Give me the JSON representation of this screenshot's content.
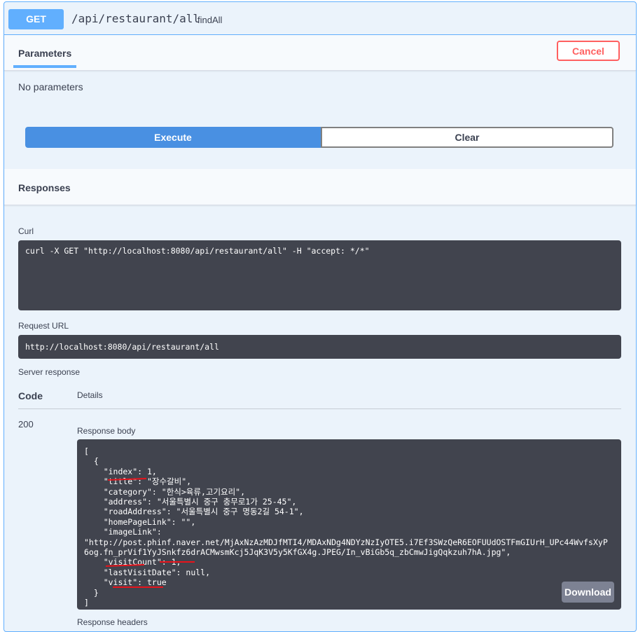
{
  "operation": {
    "method": "GET",
    "path": "/api/restaurant/all",
    "operation_id": "findAll"
  },
  "parameters": {
    "tab_label": "Parameters",
    "cancel_label": "Cancel",
    "empty_text": "No parameters"
  },
  "actions": {
    "execute_label": "Execute",
    "clear_label": "Clear"
  },
  "responses": {
    "header": "Responses",
    "curl_label": "Curl",
    "curl_command": "curl -X GET \"http://localhost:8080/api/restaurant/all\" -H \"accept: */*\"",
    "request_url_label": "Request URL",
    "request_url": "http://localhost:8080/api/restaurant/all",
    "server_response_label": "Server response",
    "code_header": "Code",
    "details_header": "Details",
    "status_code": "200",
    "response_body_label": "Response body",
    "response_body": "[\n  {\n    \"index\": 1,\n    \"title\": \"장수갈비\",\n    \"category\": \"한식>육류,고기요리\",\n    \"address\": \"서울특별시 중구 충무로1가 25-45\",\n    \"roadAddress\": \"서울특별시 중구 명동2길 54-1\",\n    \"homePageLink\": \"\",\n    \"imageLink\":\n\"http://post.phinf.naver.net/MjAxNzAzMDJfMTI4/MDAxNDg4NDYzNzIyOTE5.i7Ef3SWzQeR6EOFUUdOSTFmGIUrH_UPc44WvfsXyP\n6og.fn_prVif1YyJSnkfz6drACMwsmKcj5JqK3V5y5KfGX4g.JPEG/In_vBiGb5q_zbCmwJigQqkzuh7hA.jpg\",\n    \"visitCount\": 1,\n    \"lastVisitDate\": null,\n    \"visit\": true\n  }\n]",
    "download_label": "Download",
    "response_headers_label": "Response headers"
  }
}
